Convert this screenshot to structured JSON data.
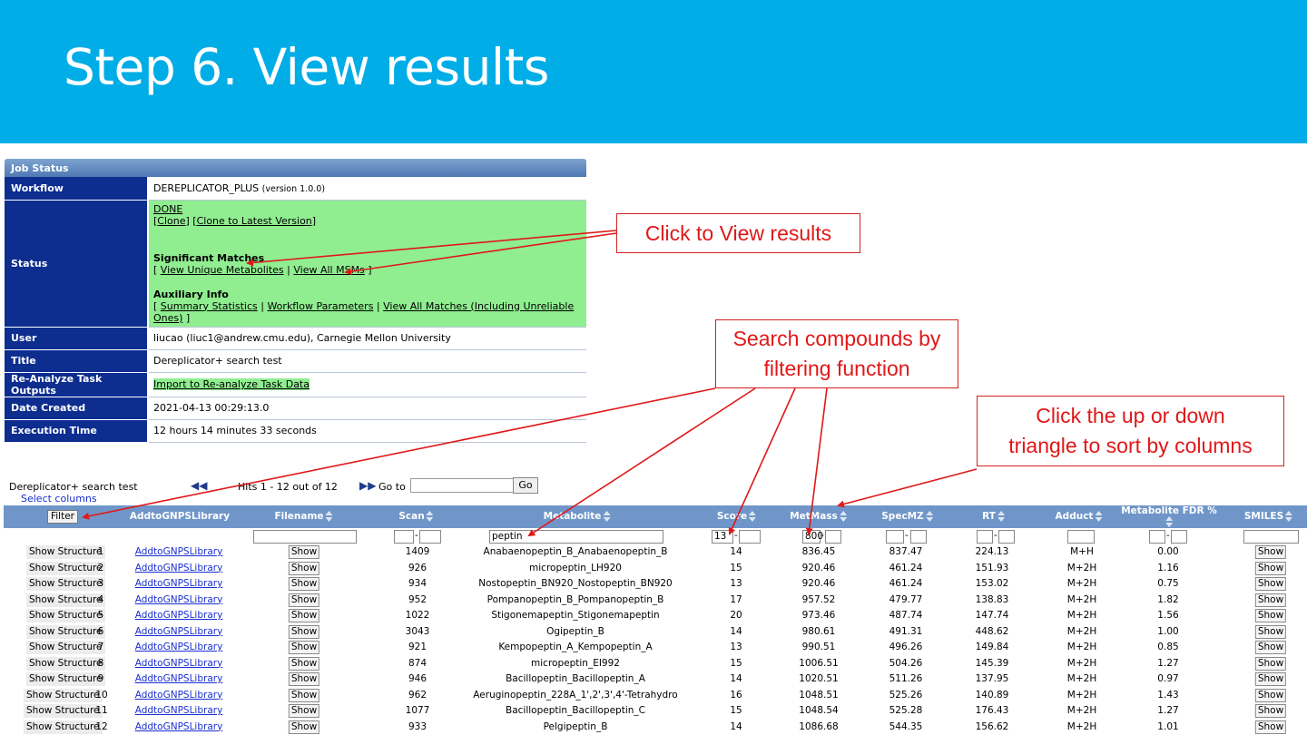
{
  "slide_title": "Step 6. View results",
  "job_status": {
    "header": "Job Status",
    "workflow_label": "Workflow",
    "workflow_name": "DEREPLICATOR_PLUS",
    "workflow_version": "(version 1.0.0)",
    "status_label": "Status",
    "status_done": "DONE",
    "clone": "[Clone]",
    "clone_latest": "[Clone to Latest Version]",
    "significant_title": "Significant Matches",
    "view_unique": "View Unique Metabolites",
    "view_all_msms": "View All MSMs",
    "auxiliary_title": "Auxiliary Info",
    "summary_stats": "Summary Statistics",
    "workflow_params": "Workflow Parameters",
    "view_all_matches": "View All Matches (Including Unreliable Ones)",
    "user_label": "User",
    "user_value": "liucao (liuc1@andrew.cmu.edu), Carnegie Mellon University",
    "title_label": "Title",
    "title_value": "Dereplicator+ search test",
    "reanalyze_label": "Re-Analyze Task Outputs",
    "reanalyze_value": "Import to Re-analyze Task Data",
    "date_label": "Date Created",
    "date_value": "2021-04-13 00:29:13.0",
    "exec_label": "Execution Time",
    "exec_value": "12 hours 14 minutes 33 seconds"
  },
  "annotations": {
    "view_results": "Click to View results",
    "search_line1": "Search compounds by",
    "search_line2": "filtering function",
    "sort_line1": "Click the up or down",
    "sort_line2": "triangle to sort by columns"
  },
  "results": {
    "task_title": "Dereplicator+ search test",
    "select_columns": "Select columns",
    "hits": "Hits 1 - 12 out of 12",
    "goto": "Go to",
    "go_button": "Go",
    "filter_button": "Filter",
    "columns": [
      "AddtoGNPSLibrary",
      "Filename",
      "Scan",
      "Metabolite",
      "Score",
      "MetMass",
      "SpecMZ",
      "RT",
      "Adduct",
      "Metabolite FDR %",
      "SMILES"
    ],
    "filters": {
      "metabolite": "peptin",
      "score_min": "13",
      "metmass_min": "800"
    },
    "show_structure": "Show Structure",
    "add_link": "AddtoGNPSLibrary",
    "show": "Show",
    "rows": [
      {
        "n": "1",
        "scan": "1409",
        "metabolite": "Anabaenopeptin_B_Anabaenopeptin_B",
        "score": "14",
        "metmass": "836.45",
        "specmz": "837.47",
        "rt": "224.13",
        "adduct": "M+H",
        "fdr": "0.00"
      },
      {
        "n": "2",
        "scan": "926",
        "metabolite": "micropeptin_LH920",
        "score": "15",
        "metmass": "920.46",
        "specmz": "461.24",
        "rt": "151.93",
        "adduct": "M+2H",
        "fdr": "1.16"
      },
      {
        "n": "3",
        "scan": "934",
        "metabolite": "Nostopeptin_BN920_Nostopeptin_BN920",
        "score": "13",
        "metmass": "920.46",
        "specmz": "461.24",
        "rt": "153.02",
        "adduct": "M+2H",
        "fdr": "0.75"
      },
      {
        "n": "4",
        "scan": "952",
        "metabolite": "Pompanopeptin_B_Pompanopeptin_B",
        "score": "17",
        "metmass": "957.52",
        "specmz": "479.77",
        "rt": "138.83",
        "adduct": "M+2H",
        "fdr": "1.82"
      },
      {
        "n": "5",
        "scan": "1022",
        "metabolite": "Stigonemapeptin_Stigonemapeptin",
        "score": "20",
        "metmass": "973.46",
        "specmz": "487.74",
        "rt": "147.74",
        "adduct": "M+2H",
        "fdr": "1.56"
      },
      {
        "n": "6",
        "scan": "3043",
        "metabolite": "Ogipeptin_B",
        "score": "14",
        "metmass": "980.61",
        "specmz": "491.31",
        "rt": "448.62",
        "adduct": "M+2H",
        "fdr": "1.00"
      },
      {
        "n": "7",
        "scan": "921",
        "metabolite": "Kempopeptin_A_Kempopeptin_A",
        "score": "13",
        "metmass": "990.51",
        "specmz": "496.26",
        "rt": "149.84",
        "adduct": "M+2H",
        "fdr": "0.85"
      },
      {
        "n": "8",
        "scan": "874",
        "metabolite": "micropeptin_EI992",
        "score": "15",
        "metmass": "1006.51",
        "specmz": "504.26",
        "rt": "145.39",
        "adduct": "M+2H",
        "fdr": "1.27"
      },
      {
        "n": "9",
        "scan": "946",
        "metabolite": "Bacillopeptin_Bacillopeptin_A",
        "score": "14",
        "metmass": "1020.51",
        "specmz": "511.26",
        "rt": "137.95",
        "adduct": "M+2H",
        "fdr": "0.97"
      },
      {
        "n": "10",
        "scan": "962",
        "metabolite": "Aeruginopeptin_228A_1',2',3',4'-Tetrahydro",
        "score": "16",
        "metmass": "1048.51",
        "specmz": "525.26",
        "rt": "140.89",
        "adduct": "M+2H",
        "fdr": "1.43"
      },
      {
        "n": "11",
        "scan": "1077",
        "metabolite": "Bacillopeptin_Bacillopeptin_C",
        "score": "15",
        "metmass": "1048.54",
        "specmz": "525.28",
        "rt": "176.43",
        "adduct": "M+2H",
        "fdr": "1.27"
      },
      {
        "n": "12",
        "scan": "933",
        "metabolite": "Pelgipeptin_B",
        "score": "14",
        "metmass": "1086.68",
        "specmz": "544.35",
        "rt": "156.62",
        "adduct": "M+2H",
        "fdr": "1.01"
      }
    ]
  }
}
